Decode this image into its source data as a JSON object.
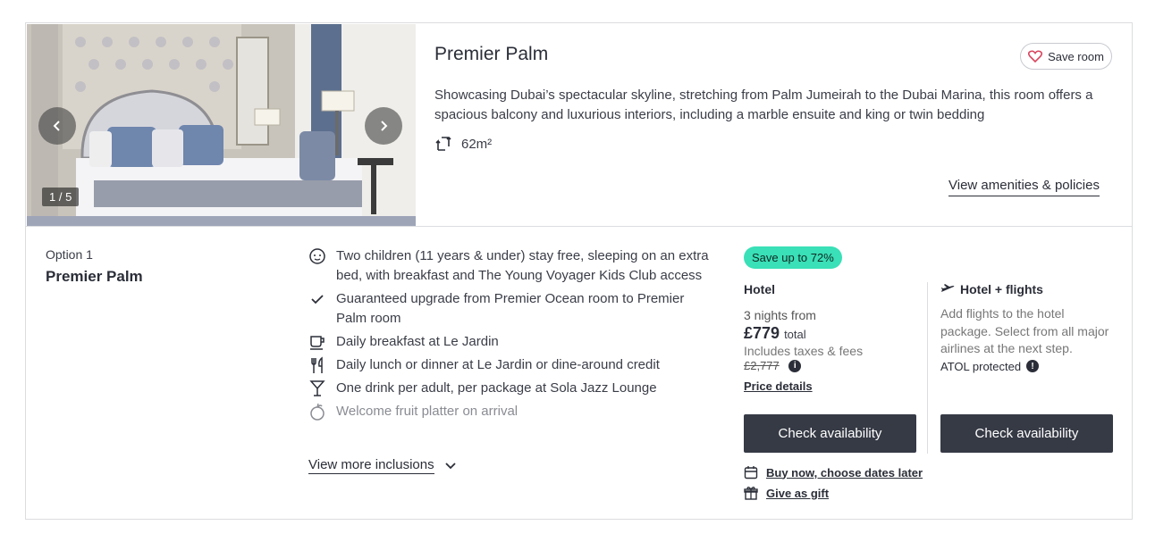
{
  "room": {
    "title": "Premier Palm",
    "save_label": "Save room",
    "description": "Showcasing Dubai’s spectacular skyline, stretching from Palm Jumeirah to the Dubai Marina, this room offers a spacious balcony and luxurious interiors, including a marble ensuite and king or twin bedding",
    "size": "62m²",
    "amenities_link": "View amenities & policies",
    "gallery_counter": "1 / 5"
  },
  "option": {
    "label": "Option 1",
    "name": "Premier Palm"
  },
  "inclusions": [
    {
      "icon": "child-face-icon",
      "text": "Two children (11 years & under) stay free, sleeping on an extra bed, with breakfast and The Young Voyager Kids Club access"
    },
    {
      "icon": "check-icon",
      "text": "Guaranteed upgrade from Premier Ocean room to Premier Palm room"
    },
    {
      "icon": "coffee-cup-icon",
      "text": "Daily breakfast at Le Jardin"
    },
    {
      "icon": "fork-knife-icon",
      "text": "Daily lunch or dinner at Le Jardin or dine-around credit"
    },
    {
      "icon": "cocktail-icon",
      "text": "One drink per adult, per package at Sola Jazz Lounge"
    },
    {
      "icon": "fruit-icon",
      "text": "Welcome fruit platter on arrival"
    }
  ],
  "view_more": "View more inclusions",
  "hotel": {
    "badge": "Save up to 72%",
    "heading": "Hotel",
    "nights": "3 nights from",
    "price": "£779",
    "price_suffix": "total",
    "taxes": "Includes taxes & fees",
    "was_price": "£2,777",
    "price_details": "Price details",
    "cta": "Check availability",
    "buy_now": "Buy now, choose dates later",
    "gift": "Give as gift"
  },
  "flights": {
    "heading": "Hotel + flights",
    "description": "Add flights to the hotel package. Select from all major airlines at the next step.",
    "atol": "ATOL protected",
    "cta": "Check availability"
  },
  "colors": {
    "badge": "#3ae0b7",
    "button": "#363a45",
    "save_heart": "#d8455f"
  }
}
